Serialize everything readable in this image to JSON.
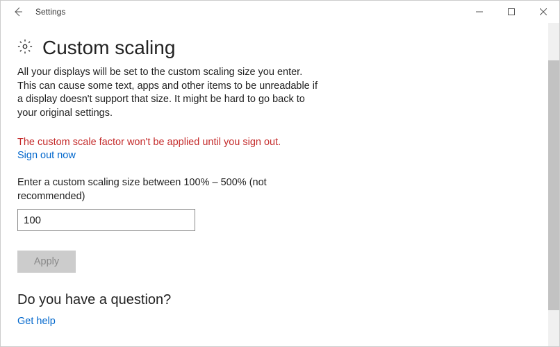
{
  "titlebar": {
    "title": "Settings"
  },
  "page": {
    "heading": "Custom scaling",
    "description": "All your displays will be set to the custom scaling size you enter. This can cause some text, apps and other items to be unreadable if a display doesn't support that size. It might be hard to go back to your original settings.",
    "warning": "The custom scale factor won't be applied until you sign out.",
    "sign_out_link": "Sign out now",
    "input_label": "Enter a custom scaling size between 100% – 500% (not recommended)",
    "input_value": "100",
    "apply_label": "Apply",
    "question_heading": "Do you have a question?",
    "help_link": "Get help"
  }
}
